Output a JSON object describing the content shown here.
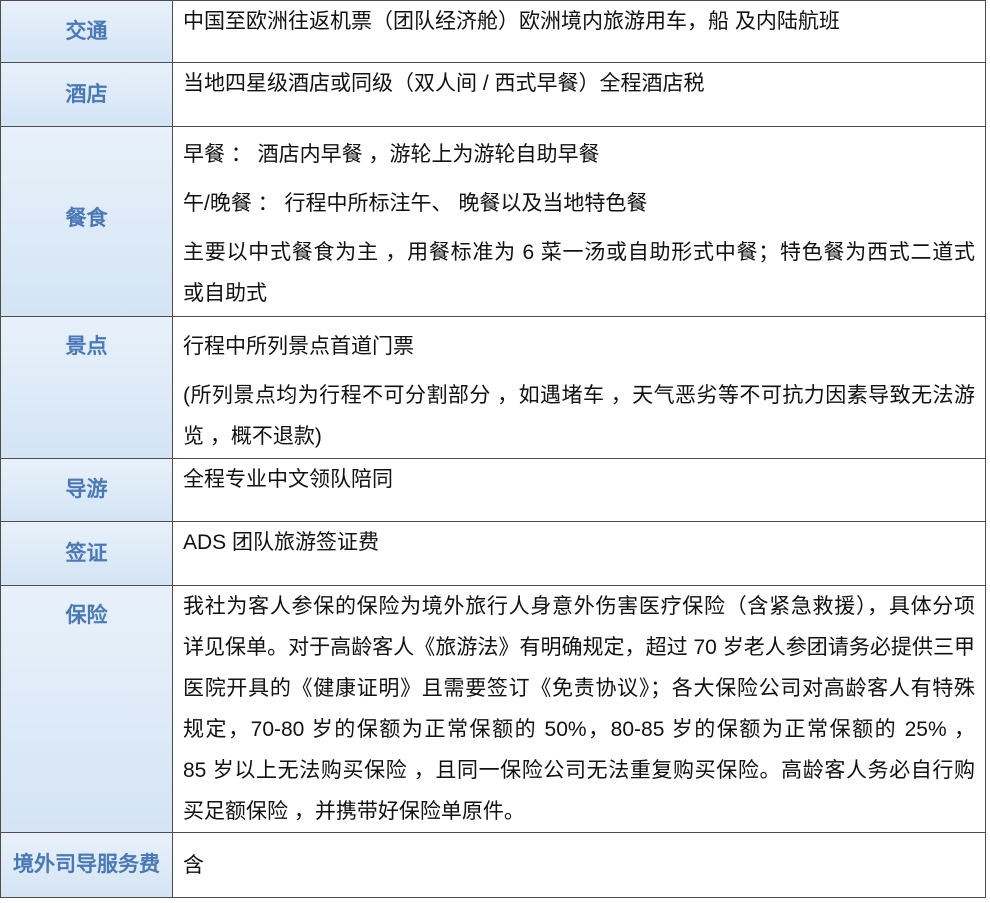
{
  "rows": [
    {
      "label": "交通",
      "paragraphs": [
        [
          "中国至欧洲往返机票（团队经济舱）欧洲境内旅游用车，船 及内陆航班"
        ]
      ]
    },
    {
      "label": "酒店",
      "paragraphs": [
        [
          "当地四星级酒店或同级（双人间 / 西式早餐）全程酒店税"
        ]
      ]
    },
    {
      "label": "餐食",
      "paragraphs": [
        [
          "早餐 ： 酒店内早餐 ，游轮上为游轮自助早餐"
        ],
        [
          "午/晚餐 ： 行程中所标注午、 晚餐以及当地特色餐"
        ],
        [
          "主要以中式餐食为主 ，用餐标准为 6 菜一汤或自助形式中餐；特色餐为西式二道式",
          "或自助式"
        ]
      ]
    },
    {
      "label": "景点",
      "paragraphs": [
        [
          "行程中所列景点首道门票"
        ],
        [
          "(所列景点均为行程不可分割部分 ，如遇堵车 ，天气恶劣等不可抗力因素导致无法游",
          "览 ，概不退款)"
        ]
      ]
    },
    {
      "label": "导游",
      "paragraphs": [
        [
          "全程专业中文领队陪同"
        ]
      ]
    },
    {
      "label": "签证",
      "paragraphs": [
        [
          "ADS 团队旅游签证费"
        ]
      ]
    },
    {
      "label": "保险",
      "paragraphs": [
        [
          "我社为客人参保的保险为境外旅行人身意外伤害医疗保险（含紧急救援），具体分项",
          "详见保单。对于高龄客人《旅游法》有明确规定，超过 70 岁老人参团请务必提供三甲",
          "医院开具的《健康证明》且需要签订《免责协议》；各大保险公司对高龄客人有特殊",
          "规定，70-80 岁的保额为正常保额的 50%，80-85 岁的保额为正常保额的 25% ，",
          "85 岁以上无法购买保险 ，且同一保险公司无法重复购买保险。高龄客人务必自行购",
          "买足额保险 ，并携带好保险单原件。"
        ]
      ]
    },
    {
      "label": "境外司导服务费",
      "paragraphs": [
        [
          "含"
        ]
      ]
    }
  ],
  "theme": {
    "label_text_color": "#4a79b8",
    "label_bg_top": "#e8f1fa",
    "label_bg_bottom": "#d4e4f5",
    "border_color": "#4d4d4d",
    "body_text_color": "#111111"
  }
}
